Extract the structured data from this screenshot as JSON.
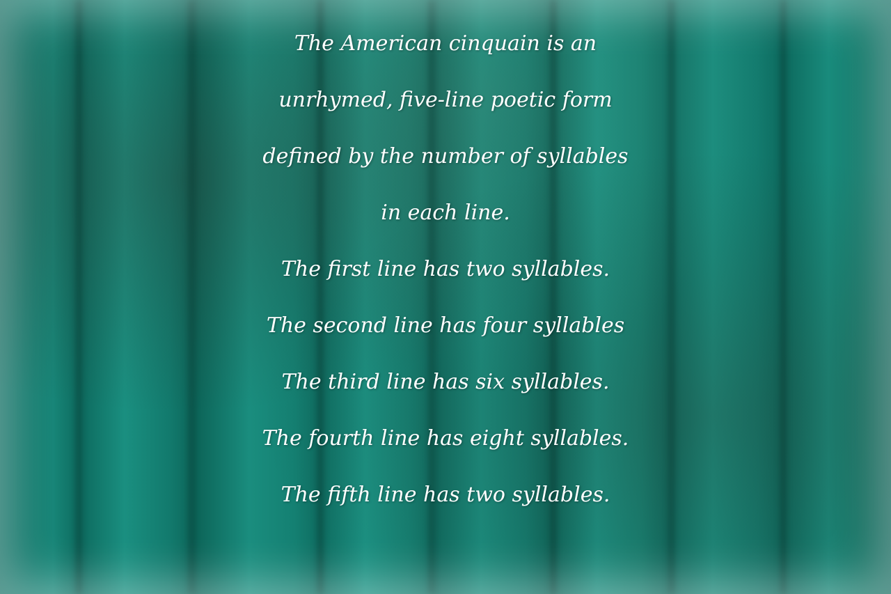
{
  "poem": {
    "lines": [
      "The American cinquain is an",
      "unrhymed, five-line poetic form",
      "defined by the number of syllables",
      "in each line.",
      "The first line has two syllables.",
      "The second line has four syllables",
      "The third line has six syllables.",
      "The fourth line has eight syllables.",
      "The fifth line has two syllables."
    ]
  },
  "colors": {
    "background": "#178577",
    "text": "#ffffff"
  }
}
